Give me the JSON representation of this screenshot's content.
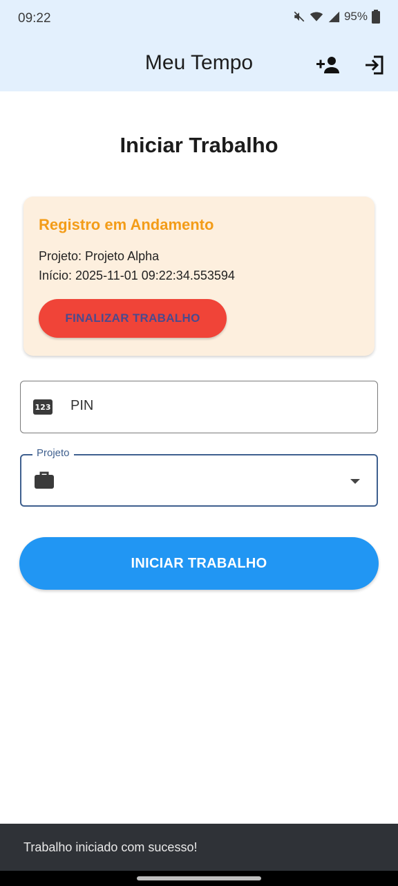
{
  "status_bar": {
    "time": "09:22",
    "battery": "95%",
    "icons": [
      "mute-icon",
      "wifi-icon",
      "signal-icon",
      "battery-icon"
    ]
  },
  "app_bar": {
    "title": "Meu Tempo",
    "actions": [
      "add-user-icon",
      "login-icon"
    ]
  },
  "page": {
    "title": "Iniciar Trabalho"
  },
  "active_record": {
    "title": "Registro em Andamento",
    "project_line": "Projeto: Projeto Alpha",
    "start_line": "Início: 2025-11-01 09:22:34.553594",
    "finish_button": "FINALIZAR TRABALHO"
  },
  "form": {
    "pin_placeholder": "PIN",
    "pin_icon": "pin-123-icon",
    "project_label": "Projeto",
    "project_value": "",
    "project_icon": "briefcase-icon",
    "submit_button": "INICIAR TRABALHO"
  },
  "snackbar": {
    "message": "Trabalho iniciado com sucesso!"
  },
  "colors": {
    "app_bar": "#e3f0fd",
    "card_bg": "#fdefde",
    "card_title": "#f39c18",
    "finish_button": "#f04438",
    "primary_button": "#2196f3",
    "focused_border": "#3e5f8e",
    "snackbar": "#2f3237"
  }
}
